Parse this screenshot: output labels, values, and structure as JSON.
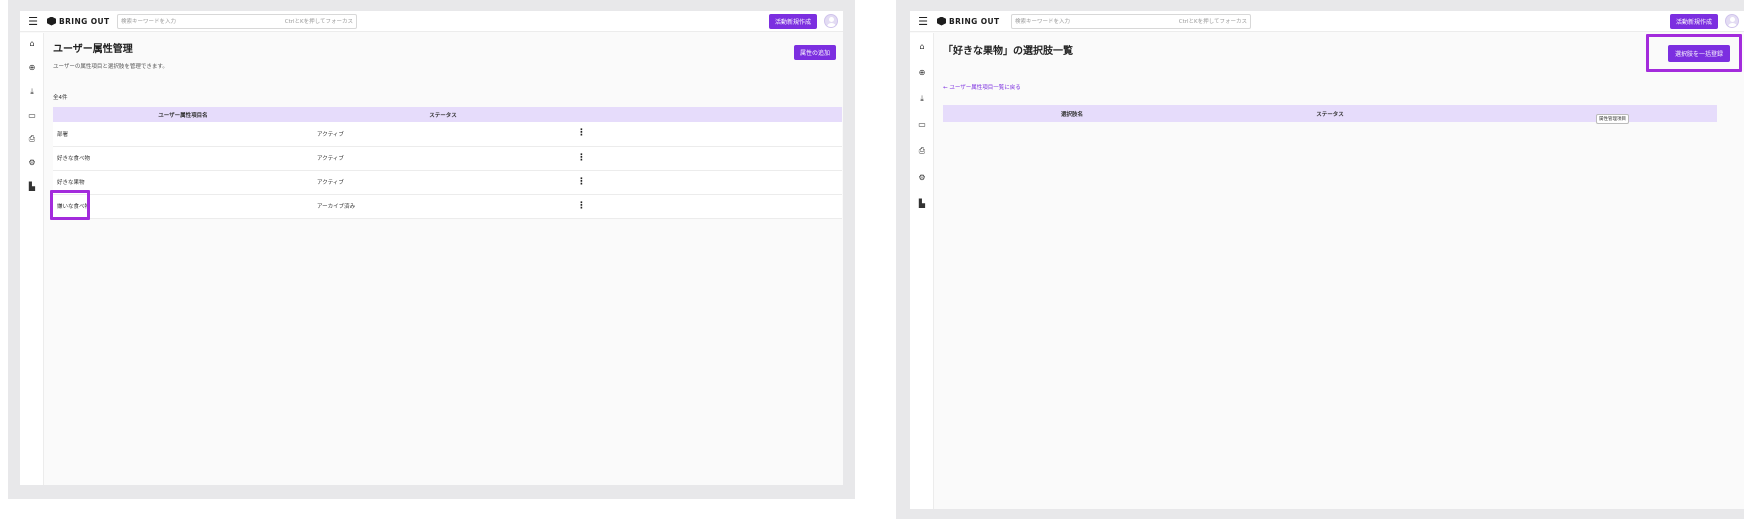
{
  "header": {
    "logo": "BRING OUT",
    "search_placeholder": "検索キーワードを入力",
    "search_hint": "CtrlとKを押してフォーカス",
    "create_button": "活動新規作成"
  },
  "sidebar": {
    "icons": [
      "menu-icon",
      "home-icon",
      "search-zoom-icon",
      "download-icon",
      "video-icon",
      "badge-icon",
      "gear-icon",
      "building-icon"
    ],
    "glyphs": [
      "☰",
      "⌂",
      "⊕",
      "⤓",
      "▭",
      "⎙",
      "⚙",
      "▙"
    ]
  },
  "left_screen": {
    "title": "ユーザー属性管理",
    "subtitle": "ユーザーの属性項目と選択肢を管理できます。",
    "add_button": "属性の追加",
    "count": "全4件",
    "columns": [
      "ユーザー属性項目名",
      "ステータス",
      ""
    ],
    "rows": [
      {
        "name": "部署",
        "status": "アクティブ"
      },
      {
        "name": "好きな食べ物",
        "status": "アクティブ"
      },
      {
        "name": "好きな果物",
        "status": "アクティブ"
      },
      {
        "name": "嫌いな食べ物",
        "status": "アーカイブ済み"
      }
    ],
    "kebab": "⋮"
  },
  "right_screen": {
    "title": "「好きな果物」の選択肢一覧",
    "back_link": "← ユーザー属性項目一覧に戻る",
    "bulk_button": "選択肢を一括登録",
    "columns": [
      "選択肢名",
      "ステータス",
      ""
    ],
    "tooltip": "属性管理項目"
  },
  "colors": {
    "accent": "#7c2fe0",
    "highlight": "#a32bdc",
    "table_header": "#e6dcfb"
  }
}
